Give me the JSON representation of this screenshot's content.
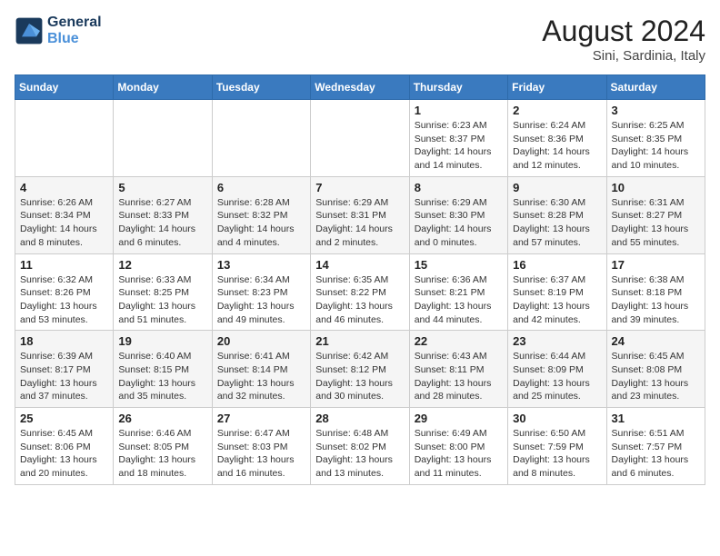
{
  "logo": {
    "line1": "General",
    "line2": "Blue"
  },
  "title": {
    "month_year": "August 2024",
    "location": "Sini, Sardinia, Italy"
  },
  "days_of_week": [
    "Sunday",
    "Monday",
    "Tuesday",
    "Wednesday",
    "Thursday",
    "Friday",
    "Saturday"
  ],
  "weeks": [
    [
      {
        "day": "",
        "info": ""
      },
      {
        "day": "",
        "info": ""
      },
      {
        "day": "",
        "info": ""
      },
      {
        "day": "",
        "info": ""
      },
      {
        "day": "1",
        "info": "Sunrise: 6:23 AM\nSunset: 8:37 PM\nDaylight: 14 hours and 14 minutes."
      },
      {
        "day": "2",
        "info": "Sunrise: 6:24 AM\nSunset: 8:36 PM\nDaylight: 14 hours and 12 minutes."
      },
      {
        "day": "3",
        "info": "Sunrise: 6:25 AM\nSunset: 8:35 PM\nDaylight: 14 hours and 10 minutes."
      }
    ],
    [
      {
        "day": "4",
        "info": "Sunrise: 6:26 AM\nSunset: 8:34 PM\nDaylight: 14 hours and 8 minutes."
      },
      {
        "day": "5",
        "info": "Sunrise: 6:27 AM\nSunset: 8:33 PM\nDaylight: 14 hours and 6 minutes."
      },
      {
        "day": "6",
        "info": "Sunrise: 6:28 AM\nSunset: 8:32 PM\nDaylight: 14 hours and 4 minutes."
      },
      {
        "day": "7",
        "info": "Sunrise: 6:29 AM\nSunset: 8:31 PM\nDaylight: 14 hours and 2 minutes."
      },
      {
        "day": "8",
        "info": "Sunrise: 6:29 AM\nSunset: 8:30 PM\nDaylight: 14 hours and 0 minutes."
      },
      {
        "day": "9",
        "info": "Sunrise: 6:30 AM\nSunset: 8:28 PM\nDaylight: 13 hours and 57 minutes."
      },
      {
        "day": "10",
        "info": "Sunrise: 6:31 AM\nSunset: 8:27 PM\nDaylight: 13 hours and 55 minutes."
      }
    ],
    [
      {
        "day": "11",
        "info": "Sunrise: 6:32 AM\nSunset: 8:26 PM\nDaylight: 13 hours and 53 minutes."
      },
      {
        "day": "12",
        "info": "Sunrise: 6:33 AM\nSunset: 8:25 PM\nDaylight: 13 hours and 51 minutes."
      },
      {
        "day": "13",
        "info": "Sunrise: 6:34 AM\nSunset: 8:23 PM\nDaylight: 13 hours and 49 minutes."
      },
      {
        "day": "14",
        "info": "Sunrise: 6:35 AM\nSunset: 8:22 PM\nDaylight: 13 hours and 46 minutes."
      },
      {
        "day": "15",
        "info": "Sunrise: 6:36 AM\nSunset: 8:21 PM\nDaylight: 13 hours and 44 minutes."
      },
      {
        "day": "16",
        "info": "Sunrise: 6:37 AM\nSunset: 8:19 PM\nDaylight: 13 hours and 42 minutes."
      },
      {
        "day": "17",
        "info": "Sunrise: 6:38 AM\nSunset: 8:18 PM\nDaylight: 13 hours and 39 minutes."
      }
    ],
    [
      {
        "day": "18",
        "info": "Sunrise: 6:39 AM\nSunset: 8:17 PM\nDaylight: 13 hours and 37 minutes."
      },
      {
        "day": "19",
        "info": "Sunrise: 6:40 AM\nSunset: 8:15 PM\nDaylight: 13 hours and 35 minutes."
      },
      {
        "day": "20",
        "info": "Sunrise: 6:41 AM\nSunset: 8:14 PM\nDaylight: 13 hours and 32 minutes."
      },
      {
        "day": "21",
        "info": "Sunrise: 6:42 AM\nSunset: 8:12 PM\nDaylight: 13 hours and 30 minutes."
      },
      {
        "day": "22",
        "info": "Sunrise: 6:43 AM\nSunset: 8:11 PM\nDaylight: 13 hours and 28 minutes."
      },
      {
        "day": "23",
        "info": "Sunrise: 6:44 AM\nSunset: 8:09 PM\nDaylight: 13 hours and 25 minutes."
      },
      {
        "day": "24",
        "info": "Sunrise: 6:45 AM\nSunset: 8:08 PM\nDaylight: 13 hours and 23 minutes."
      }
    ],
    [
      {
        "day": "25",
        "info": "Sunrise: 6:45 AM\nSunset: 8:06 PM\nDaylight: 13 hours and 20 minutes."
      },
      {
        "day": "26",
        "info": "Sunrise: 6:46 AM\nSunset: 8:05 PM\nDaylight: 13 hours and 18 minutes."
      },
      {
        "day": "27",
        "info": "Sunrise: 6:47 AM\nSunset: 8:03 PM\nDaylight: 13 hours and 16 minutes."
      },
      {
        "day": "28",
        "info": "Sunrise: 6:48 AM\nSunset: 8:02 PM\nDaylight: 13 hours and 13 minutes."
      },
      {
        "day": "29",
        "info": "Sunrise: 6:49 AM\nSunset: 8:00 PM\nDaylight: 13 hours and 11 minutes."
      },
      {
        "day": "30",
        "info": "Sunrise: 6:50 AM\nSunset: 7:59 PM\nDaylight: 13 hours and 8 minutes."
      },
      {
        "day": "31",
        "info": "Sunrise: 6:51 AM\nSunset: 7:57 PM\nDaylight: 13 hours and 6 minutes."
      }
    ]
  ]
}
